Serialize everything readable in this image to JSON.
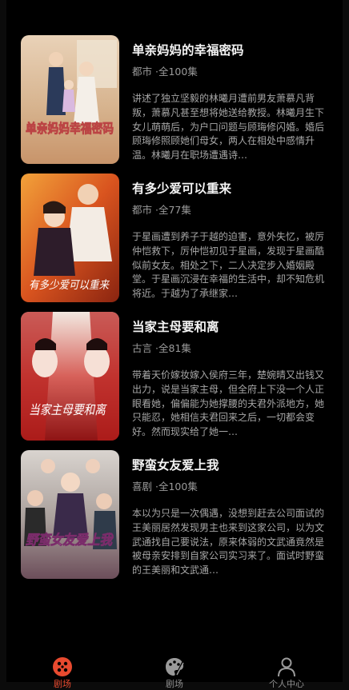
{
  "dramas": [
    {
      "title": "单亲妈妈的幸福密码",
      "genre": "都市",
      "episodes": "·全100集",
      "description": "讲述了独立坚毅的林曦月遭前男友萧慕凡背叛，萧慕凡甚至想将她送给教授。林曦月生下女儿萌萌后，为户口问题与顾珻修闪婚。婚后顾珻修照顾她们母女，两人在相处中感情升温。林曦月在职场遭遇诗…",
      "poster_text": "单亲妈妈幸福密码"
    },
    {
      "title": "有多少爱可以重来",
      "genre": "都市",
      "episodes": "·全77集",
      "description": "于星画遭到养子于越的迫害，意外失忆，被厉仲恺救下，厉仲恺初见于星画，发现于星画酷似前女友。相处之下，二人决定步入婚姻殿堂。于星画沉浸在幸福的生活中，却不知危机将近。于越为了承继家…",
      "poster_text": "有多少爱可以重来"
    },
    {
      "title": "当家主母要和离",
      "genre": "古言",
      "episodes": "·全81集",
      "description": "带着天价嫁妆嫁入侯府三年，楚婉晴又出钱又出力，说是当家主母，但全府上下没一个人正眼看她，偏偏能为她撑腰的夫君外派地方，她只能忍，她相信夫君回来之后，一切都会变好。然而现实给了她一…",
      "poster_text": "当家主母要和离"
    },
    {
      "title": "野蛮女友爱上我",
      "genre": "喜剧",
      "episodes": "·全100集",
      "description": "本以为只是一次偶遇，没想到赶去公司面试的王美丽居然发现男主也来到这家公司，以为文武通找自己要说法，原来体弱的文武通竟然是被母亲安排到自家公司实习来了。面试时野蛮的王美丽和文武通…",
      "poster_text": "野蛮女友爱上我"
    }
  ],
  "tabbar": {
    "tabs": [
      {
        "icon": "theater-icon",
        "label": "剧场",
        "active": true
      },
      {
        "icon": "palette-icon",
        "label": "剧场",
        "active": false
      },
      {
        "icon": "profile-icon",
        "label": "个人中心",
        "active": false
      }
    ],
    "active_color": "#e84a2f"
  }
}
